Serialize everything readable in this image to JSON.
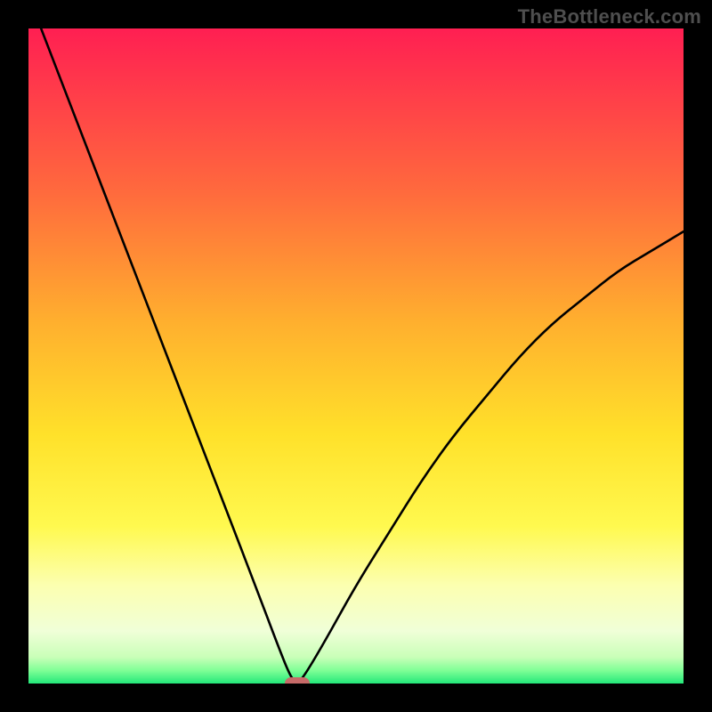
{
  "watermark": "TheBottleneck.com",
  "chart_data": {
    "type": "line",
    "title": "",
    "xlabel": "",
    "ylabel": "",
    "xlim": [
      0,
      100
    ],
    "ylim": [
      0,
      100
    ],
    "series": [
      {
        "name": "bottleneck-curve",
        "x": [
          0,
          5,
          10,
          15,
          20,
          25,
          30,
          35,
          38,
          40,
          41,
          42,
          45,
          50,
          55,
          60,
          65,
          70,
          75,
          80,
          85,
          90,
          95,
          100
        ],
        "y": [
          105,
          92,
          79,
          66,
          53,
          40,
          27,
          14,
          6,
          1,
          0,
          1,
          6,
          15,
          23,
          31,
          38,
          44,
          50,
          55,
          59,
          63,
          66,
          69
        ]
      }
    ],
    "minimum_point": {
      "x": 41,
      "y": 0
    },
    "marker_color": "#c66a68",
    "curve_color": "#000000",
    "background_gradient_stops": [
      {
        "offset": 0,
        "color": "#ff1f52"
      },
      {
        "offset": 25,
        "color": "#ff6a3d"
      },
      {
        "offset": 45,
        "color": "#ffb02e"
      },
      {
        "offset": 62,
        "color": "#ffe12a"
      },
      {
        "offset": 76,
        "color": "#fff94f"
      },
      {
        "offset": 85,
        "color": "#fcffb0"
      },
      {
        "offset": 92,
        "color": "#f0ffd8"
      },
      {
        "offset": 96,
        "color": "#c9ffb8"
      },
      {
        "offset": 98,
        "color": "#7fff96"
      },
      {
        "offset": 100,
        "color": "#23e87a"
      }
    ]
  }
}
